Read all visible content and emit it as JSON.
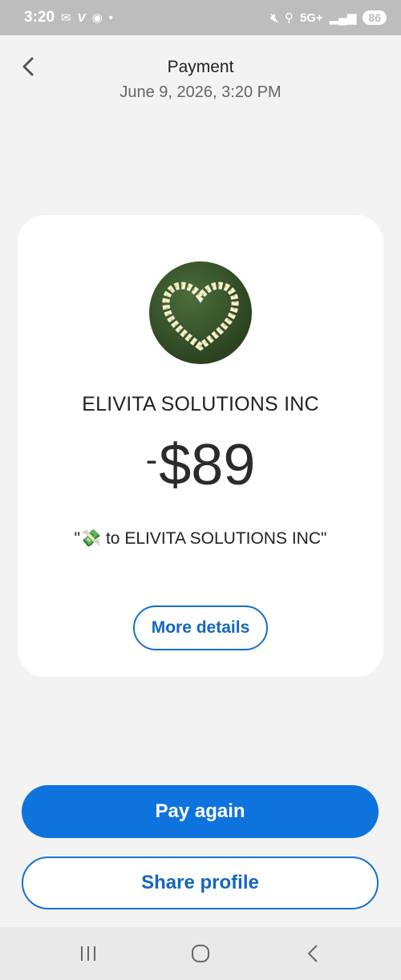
{
  "status_bar": {
    "time": "3:20",
    "network": "5G+",
    "battery": "86",
    "left_icons": [
      "mail-icon",
      "venmo-icon",
      "messenger-icon",
      "dot-icon"
    ],
    "right_icons": [
      "mute-icon",
      "location-icon",
      "signal-icon",
      "battery-icon"
    ]
  },
  "header": {
    "title": "Payment",
    "subtitle": "June 9, 2026, 3:20 PM"
  },
  "transaction": {
    "recipient": "ELIVITA SOLUTIONS INC",
    "amount_sign": "-",
    "amount": "$89",
    "note": "\"💸 to ELIVITA SOLUTIONS INC\""
  },
  "buttons": {
    "more_details": "More details",
    "pay_again": "Pay again",
    "share_profile": "Share profile"
  },
  "colors": {
    "accent": "#0e73dd",
    "accent_text": "#1466c2",
    "background": "#f3f3f3",
    "card": "#ffffff"
  }
}
